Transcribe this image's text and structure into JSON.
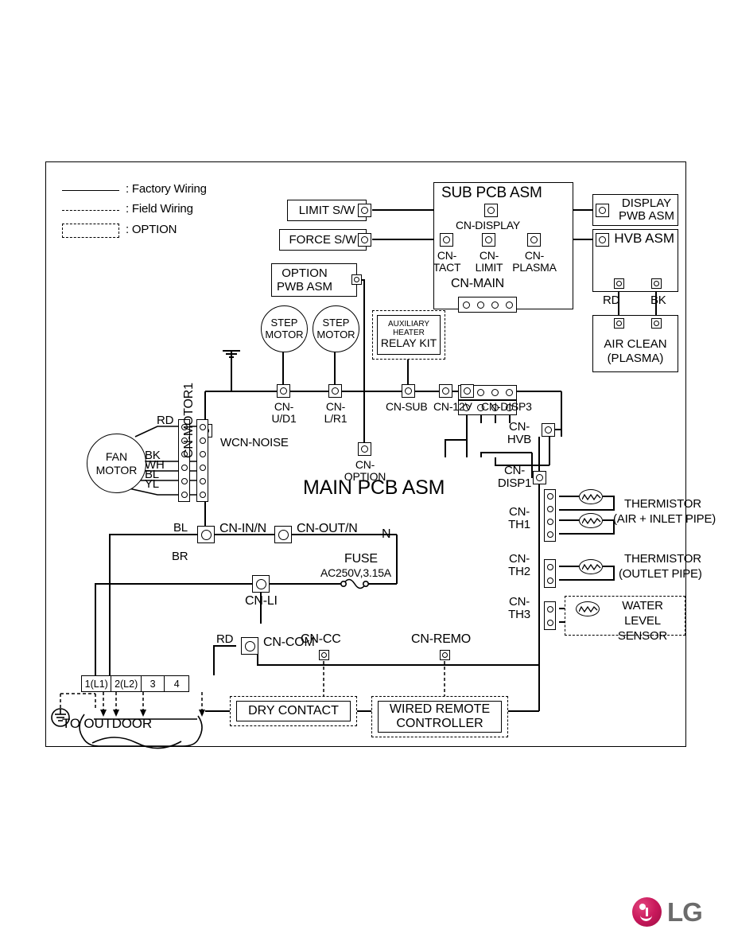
{
  "page": {
    "brand": "LG"
  },
  "legend": {
    "factory_wiring": ": Factory Wiring",
    "field_wiring": ": Field Wiring",
    "option": ": OPTION"
  },
  "blocks": {
    "limit_sw": "LIMIT S/W",
    "force_sw": "FORCE S/W",
    "sub_pcb_asm": "SUB PCB ASM",
    "display_pwb_asm": "DISPLAY\nPWB ASM",
    "hvb_asm": "HVB ASM",
    "air_clean": "AIR CLEAN\n(PLASMA)",
    "option_pwb_asm": "OPTION\nPWB ASM",
    "step_motor_1": "STEP\nMOTOR",
    "step_motor_2": "STEP\nMOTOR",
    "aux_heater": "AUXILIARY HEATER",
    "relay_kit": "RELAY KIT",
    "main_pcb_asm": "MAIN PCB ASM",
    "fan_motor": "FAN\nMOTOR",
    "dry_contact": "DRY CONTACT",
    "wired_remote_controller": "WIRED REMOTE\nCONTROLLER",
    "to_outdoor": "TO OUTDOOR",
    "thermistor_1_name": "THERMISTOR",
    "thermistor_1_detail": "(AIR + INLET PIPE)",
    "thermistor_2_name": "THERMISTOR",
    "thermistor_2_detail": "(OUTLET PIPE)",
    "water_level_sensor": "WATER LEVEL\nSENSOR"
  },
  "connectors": {
    "cn_display": "CN-DISPLAY",
    "cn_tact": "CN-\nTACT",
    "cn_limit": "CN-\nLIMIT",
    "cn_plasma": "CN-\nPLASMA",
    "cn_main": "CN-MAIN",
    "cn_ud1": "CN-\nU/D1",
    "cn_lr1": "CN-\nL/R1",
    "cn_sub": "CN-SUB",
    "cn_12v": "CN-12V",
    "cn_disp3": "CN-DISP3",
    "cn_motor1": "CN-MOTOR1",
    "wcn_noise": "WCN-NOISE",
    "cn_option": "CN-\nOPTION",
    "cn_hvb": "CN-\nHVB",
    "cn_disp1": "CN-\nDISP1",
    "cn_th1": "CN-\nTH1",
    "cn_th2": "CN-\nTH2",
    "cn_th3": "CN-\nTH3",
    "cn_in_n": "CN-IN/N",
    "cn_out_n": "CN-OUT/N",
    "cn_li": "CN-LI",
    "cn_com": "CN-COM",
    "cn_cc": "CN-CC",
    "cn_remo": "CN-REMO"
  },
  "wire_labels": {
    "rd_fan": "RD",
    "bk_fan": "BK",
    "wh_fan": "WH",
    "bl_fan": "BL",
    "yl_fan": "YL",
    "rd_hvb": "RD",
    "bk_hvb": "BK",
    "bl_line": "BL",
    "br_line": "BR",
    "rd_com": "RD",
    "n_line": "N"
  },
  "fuse": {
    "title": "FUSE",
    "rating": "AC250V,3.15A"
  },
  "terminal_block": {
    "cells": [
      "1(L1)",
      "2(L2)",
      "3",
      "4"
    ]
  }
}
